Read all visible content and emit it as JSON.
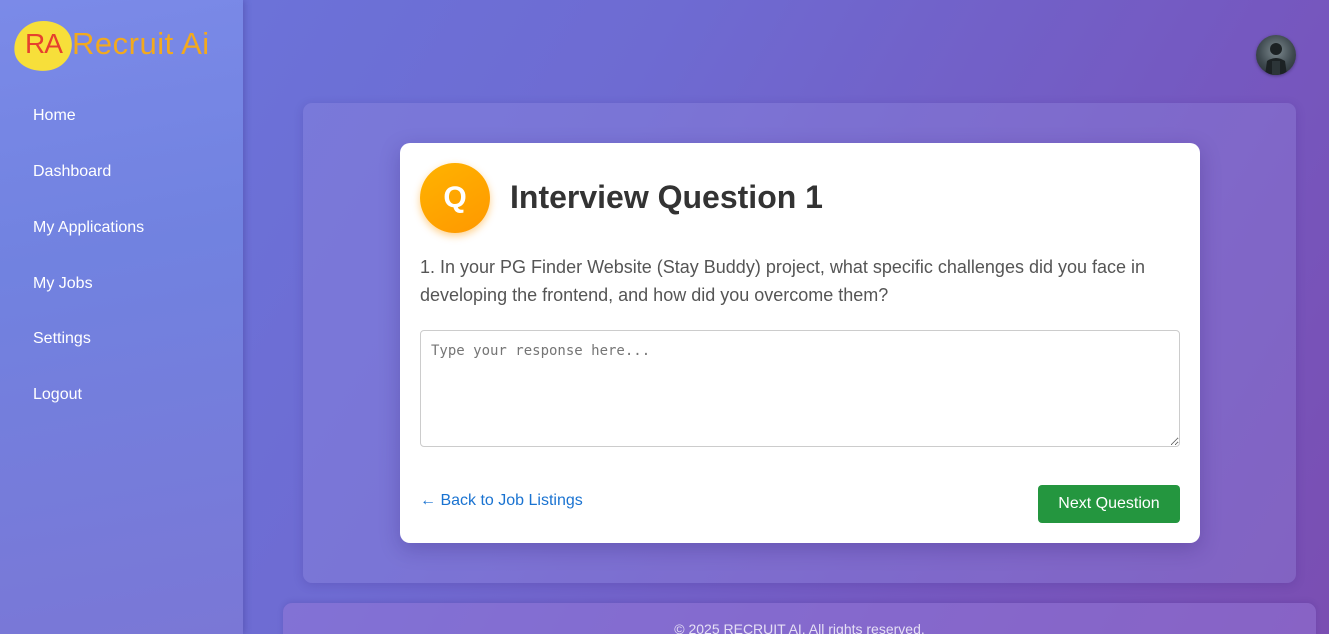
{
  "brand": {
    "badge": "RA",
    "name": "Recruit Ai"
  },
  "nav": {
    "items": [
      {
        "label": "Home"
      },
      {
        "label": "Dashboard"
      },
      {
        "label": "My Applications"
      },
      {
        "label": "My Jobs"
      },
      {
        "label": "Settings"
      },
      {
        "label": "Logout"
      }
    ]
  },
  "question": {
    "badge": "Q",
    "title": "Interview Question 1",
    "text": "1. In your PG Finder Website (Stay Buddy) project, what specific challenges did you face in developing the frontend, and how did you overcome them?"
  },
  "response": {
    "placeholder": "Type your response here...",
    "value": ""
  },
  "actions": {
    "back_label": "← Back to Job Listings",
    "next_label": "Next Question"
  },
  "footer": {
    "copyright": "© 2025 RECRUIT AI. All rights reserved."
  },
  "colors": {
    "accent_orange": "#ff9800",
    "next_green": "#24963f",
    "link_blue": "#1a73d1",
    "logo_yellow": "#f7df3a",
    "logo_text": "#f2a91e"
  }
}
